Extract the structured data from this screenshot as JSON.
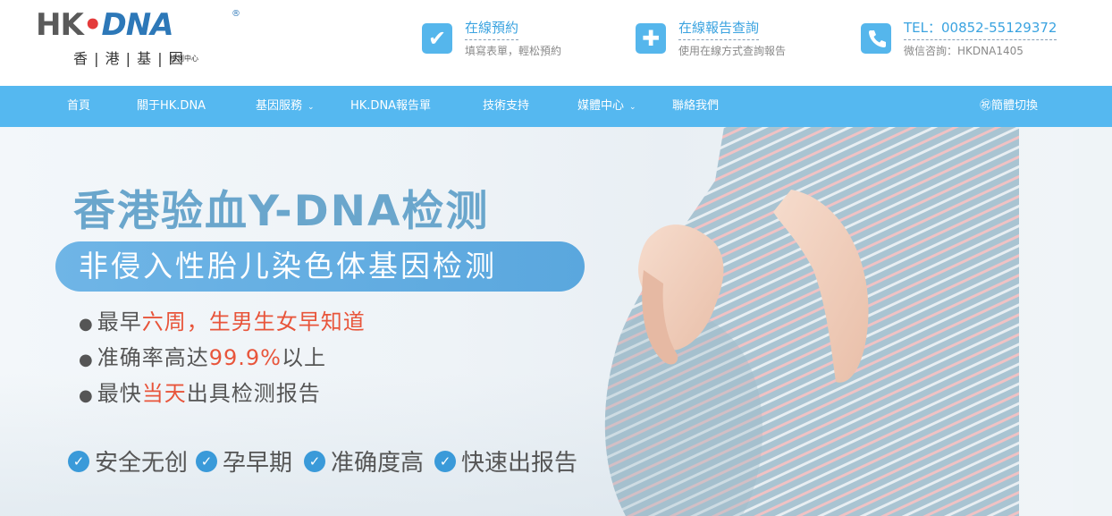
{
  "logo": {
    "brand_left": "HK",
    "brand_dot": "•",
    "brand_right": "DNA",
    "registered": "®",
    "name_cn": "香 | 港 | 基 | 因",
    "name_sub": "檢測中心"
  },
  "header_info": [
    {
      "icon": "checkbox-icon",
      "title": "在線預約",
      "subtitle": "填寫表單，輕松預約"
    },
    {
      "icon": "plus-icon",
      "title": "在線報告查詢",
      "subtitle": "使用在線方式查詢報告"
    },
    {
      "icon": "phone-icon",
      "title": "TEL：00852-55129372",
      "subtitle": "微信咨詢：HKDNA1405"
    }
  ],
  "nav": {
    "items": [
      {
        "label": "首頁",
        "has_dropdown": false
      },
      {
        "label": "關于HK.DNA",
        "has_dropdown": false
      },
      {
        "label": "基因服務",
        "has_dropdown": true
      },
      {
        "label": "HK.DNA報告單",
        "has_dropdown": false
      },
      {
        "label": "技術支持",
        "has_dropdown": false
      },
      {
        "label": "媒體中心",
        "has_dropdown": true
      },
      {
        "label": "聯絡我們",
        "has_dropdown": false
      }
    ],
    "lang_switch": "㊗簡體切換",
    "chevron": "⌄"
  },
  "banner": {
    "headline": "香港验血Y-DNA检测",
    "pill_text": "非侵入性胎儿染色体基因检测",
    "bullets": [
      {
        "prefix": "最早",
        "highlight": "六周，生男生女早知道",
        "suffix": ""
      },
      {
        "prefix": "准确率高达",
        "highlight": "99.9%",
        "suffix": "以上"
      },
      {
        "prefix": "最快",
        "highlight": "当天",
        "suffix": "出具检测报告"
      }
    ],
    "features": [
      "安全无创",
      "孕早期",
      "准确度高",
      "快速出报告"
    ],
    "check_glyph": "✓",
    "bullet_glyph": "●"
  },
  "colors": {
    "nav_bg": "#55b8f0",
    "accent_blue": "#3aa3e0",
    "headline": "#6aa6cc",
    "highlight_red": "#e8553b"
  }
}
